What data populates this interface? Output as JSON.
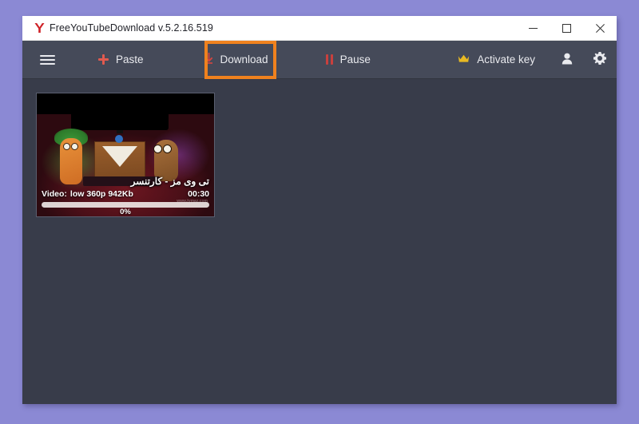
{
  "window": {
    "title": "FreeYouTubeDownload  v.5.2.16.519",
    "logo_icon": "y-logo-icon",
    "controls": {
      "minimize_icon": "minimize-icon",
      "maximize_icon": "maximize-icon",
      "close_icon": "close-icon"
    }
  },
  "toolbar": {
    "menu_icon": "hamburger-menu-icon",
    "paste_label": "Paste",
    "paste_icon": "plus-icon",
    "download_label": "Download",
    "download_icon": "download-arrow-icon",
    "pause_label": "Pause",
    "pause_icon": "pause-icon",
    "activate_label": "Activate key",
    "activate_icon": "crown-icon",
    "account_icon": "user-icon",
    "settings_icon": "gear-icon",
    "highlight_color": "#f0821e",
    "accent_red": "#e05a4f",
    "crown_gold": "#e8b923"
  },
  "downloads": {
    "items": [
      {
        "title_fa": "تی وی مز - کارتنسر",
        "video_label": "Video:",
        "quality": "low",
        "resolution": "360p",
        "size": "942Kb",
        "duration": "00:30",
        "progress_percent": "0%",
        "progress_value": 0,
        "watermark": "www.tvmaz.com"
      }
    ]
  },
  "colors": {
    "desktop_background": "#8b89d4",
    "titlebar_background": "#ffffff",
    "toolbar_background": "#454a59",
    "content_background": "#383c4a"
  }
}
